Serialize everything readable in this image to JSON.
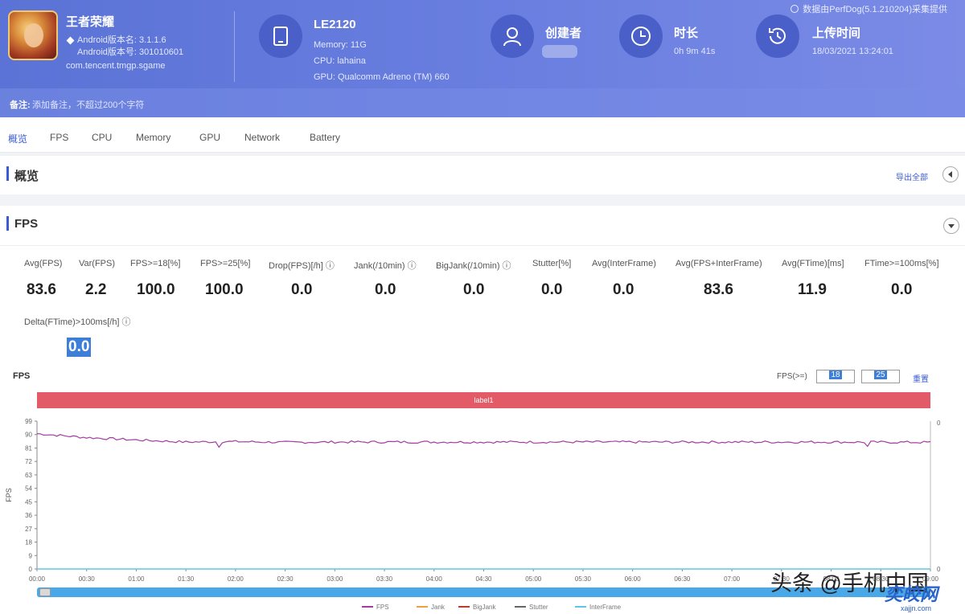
{
  "header": {
    "app_name": "王者荣耀",
    "android_version_name": "Android版本名: 3.1.1.6",
    "android_version_code": "Android版本号: 301010601",
    "package": "com.tencent.tmgp.sgame",
    "device_name": "LE2120",
    "memory": "Memory: 11G",
    "cpu": "CPU: lahaina",
    "gpu": "GPU: Qualcomm Adreno (TM) 660",
    "creator_label": "创建者",
    "duration_label": "时长",
    "duration_value": "0h 9m 41s",
    "upload_label": "上传时间",
    "upload_value": "18/03/2021 13:24:01",
    "version_note": "数据由PerfDog(5.1.210204)采集提供",
    "notes_label": "备注:",
    "notes_value": "添加备注，不超过200个字符"
  },
  "tabs": [
    "概览",
    "FPS",
    "CPU",
    "Memory",
    "GPU",
    "Network",
    "Battery"
  ],
  "overview": {
    "title": "概览",
    "export_link": "导出全部"
  },
  "fps_section": {
    "title": "FPS",
    "metrics": [
      {
        "label": "Avg(FPS)",
        "value": "83.6"
      },
      {
        "label": "Var(FPS)",
        "value": "2.2"
      },
      {
        "label": "FPS>=18[%]",
        "value": "100.0"
      },
      {
        "label": "FPS>=25[%]",
        "value": "100.0"
      },
      {
        "label": "Drop(FPS)[/h] ⓘ",
        "value": "0.0"
      },
      {
        "label": "Jank(/10min) ⓘ",
        "value": "0.0"
      },
      {
        "label": "BigJank(/10min) ⓘ",
        "value": "0.0"
      },
      {
        "label": "Stutter[%]",
        "value": "0.0"
      },
      {
        "label": "Avg(InterFrame)",
        "value": "0.0"
      },
      {
        "label": "Avg(FPS+InterFrame)",
        "value": "83.6"
      },
      {
        "label": "Avg(FTime)[ms]",
        "value": "11.9"
      },
      {
        "label": "FTime>=100ms[%]",
        "value": "0.0"
      },
      {
        "label": "Delta(FTime)>100ms[/h] ⓘ",
        "value": "0.0"
      }
    ]
  },
  "chart_controls": {
    "chart_label": "FPS",
    "fps_threshold_label": "FPS(>=)",
    "threshold_1": "18",
    "threshold_2": "25",
    "reset_label": "重置",
    "label_bar": "label1"
  },
  "chart_data": {
    "type": "line",
    "ylabel": "FPS",
    "ylim": [
      0,
      99
    ],
    "y_ticks": [
      "99",
      "90",
      "81",
      "72",
      "63",
      "54",
      "45",
      "36",
      "27",
      "18",
      "9",
      "0"
    ],
    "x_ticks": [
      "00:00",
      "00:30",
      "01:00",
      "01:30",
      "02:00",
      "02:30",
      "03:00",
      "03:30",
      "04:00",
      "04:30",
      "05:00",
      "05:30",
      "06:00",
      "06:30",
      "07:00",
      "07:30",
      "08:00",
      "08:30",
      "09:00"
    ],
    "right_axis_ticks": [
      "0",
      "0"
    ],
    "grid": false,
    "series": [
      {
        "name": "FPS",
        "color": "#a23ca0",
        "points": [
          [
            0,
            90.6
          ],
          [
            30,
            88
          ],
          [
            60,
            86.4
          ],
          [
            90,
            85
          ],
          [
            120,
            85.3
          ],
          [
            150,
            84.8
          ],
          [
            180,
            85
          ],
          [
            240,
            85
          ],
          [
            300,
            85
          ],
          [
            360,
            85
          ],
          [
            420,
            85
          ],
          [
            480,
            85
          ],
          [
            540,
            84.8
          ]
        ]
      },
      {
        "name": "InterFrame",
        "color": "#5bc6e8",
        "points": [
          [
            0,
            0
          ],
          [
            540,
            0
          ]
        ]
      }
    ],
    "legend": [
      "FPS",
      "Jank",
      "BigJank",
      "Stutter",
      "InterFrame"
    ],
    "legend_colors": [
      "#a23ca0",
      "#f0a040",
      "#c0392b",
      "#666666",
      "#5bc6e8"
    ],
    "legend_position": "bottom"
  },
  "watermark": {
    "text": "头条 @手机中国",
    "site": "奕皎网",
    "url": "xajjn.com"
  }
}
